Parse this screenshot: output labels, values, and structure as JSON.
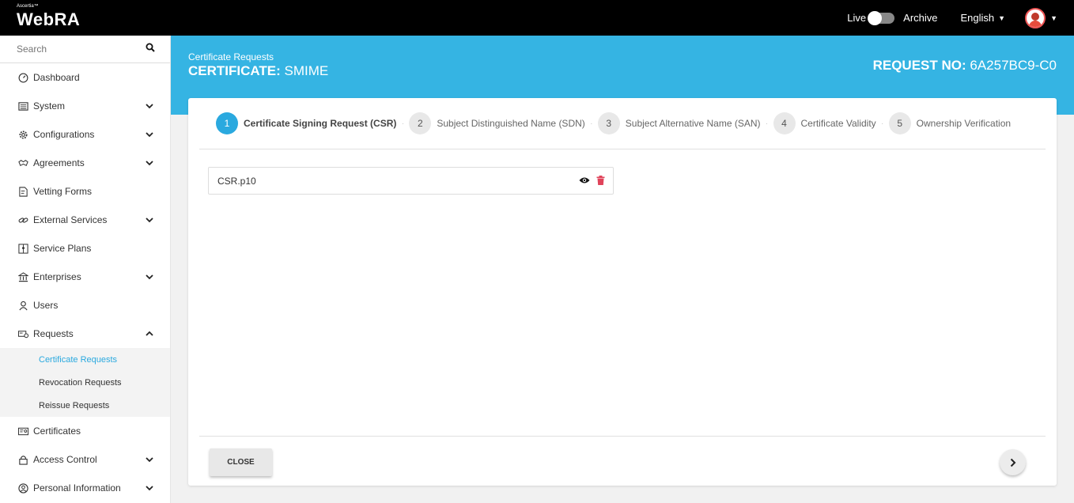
{
  "topbar": {
    "logo_small": "Ascertia™",
    "logo_main": "WebRA",
    "live_label": "Live",
    "archive_label": "Archive",
    "language": "English"
  },
  "sidebar": {
    "search_placeholder": "Search",
    "items": [
      {
        "label": "Dashboard",
        "icon": "dashboard-icon",
        "expandable": false
      },
      {
        "label": "System",
        "icon": "system-icon",
        "expandable": true
      },
      {
        "label": "Configurations",
        "icon": "gear-icon",
        "expandable": true
      },
      {
        "label": "Agreements",
        "icon": "handshake-icon",
        "expandable": true
      },
      {
        "label": "Vetting Forms",
        "icon": "form-icon",
        "expandable": false
      },
      {
        "label": "External Services",
        "icon": "link-icon",
        "expandable": true
      },
      {
        "label": "Service Plans",
        "icon": "plan-icon",
        "expandable": false
      },
      {
        "label": "Enterprises",
        "icon": "building-icon",
        "expandable": true
      },
      {
        "label": "Users",
        "icon": "user-icon",
        "expandable": false
      },
      {
        "label": "Requests",
        "icon": "request-icon",
        "expandable": true,
        "expanded": true
      },
      {
        "label": "Certificates",
        "icon": "certificate-icon",
        "expandable": false
      },
      {
        "label": "Access Control",
        "icon": "lock-icon",
        "expandable": true
      },
      {
        "label": "Personal Information",
        "icon": "person-circle-icon",
        "expandable": true
      }
    ],
    "requests_sub": [
      {
        "label": "Certificate Requests",
        "active": true
      },
      {
        "label": "Revocation Requests",
        "active": false
      },
      {
        "label": "Reissue Requests",
        "active": false
      }
    ]
  },
  "header": {
    "breadcrumb": "Certificate Requests",
    "title_prefix": "CERTIFICATE:",
    "title_value": "SMIME",
    "request_prefix": "REQUEST NO:",
    "request_value": "6A257BC9-C0"
  },
  "steps": [
    {
      "num": "1",
      "label": "Certificate Signing Request (CSR)",
      "active": true
    },
    {
      "num": "2",
      "label": "Subject Distinguished Name (SDN)",
      "active": false
    },
    {
      "num": "3",
      "label": "Subject Alternative Name (SAN)",
      "active": false
    },
    {
      "num": "4",
      "label": "Certificate Validity",
      "active": false
    },
    {
      "num": "5",
      "label": "Ownership Verification",
      "active": false
    }
  ],
  "file": {
    "name": "CSR.p10"
  },
  "buttons": {
    "close": "CLOSE"
  },
  "colors": {
    "accent": "#35b4e3",
    "active_step": "#2aa9df",
    "delete": "#e0435a"
  }
}
